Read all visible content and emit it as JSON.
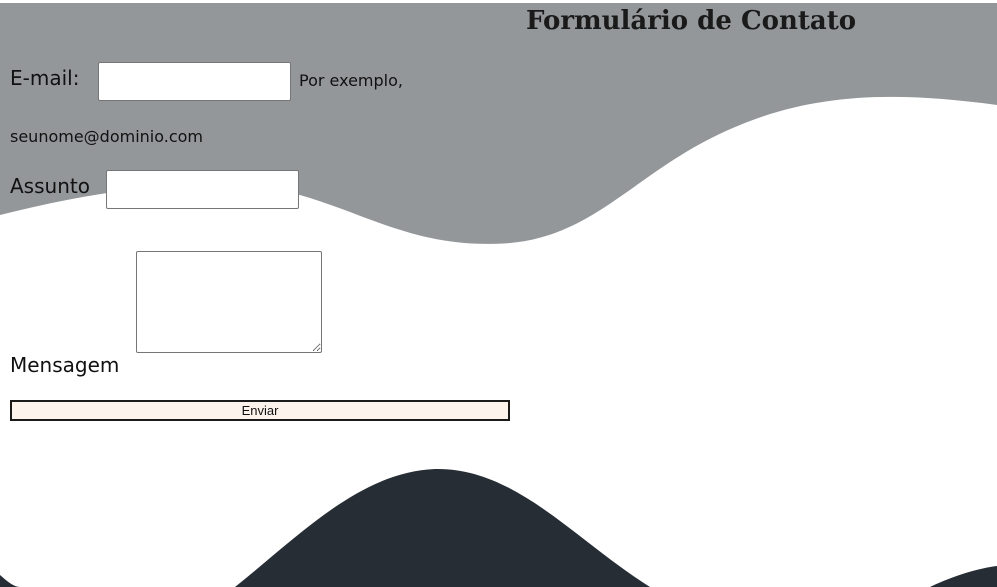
{
  "form": {
    "title": "Formulário de Contato",
    "email_label": "E-mail:",
    "email_value": "",
    "email_hint_line1": "Por exemplo,",
    "email_hint_line2": "seunome@dominio.com",
    "subject_label": "Assunto",
    "subject_value": "",
    "message_label": "Mensagem",
    "message_value": "",
    "submit_label": "Enviar"
  },
  "colors": {
    "top_wave": "#939799",
    "bottom_wave": "#272d35",
    "background": "#ffffff",
    "button_bg": "#fcf3ec"
  }
}
